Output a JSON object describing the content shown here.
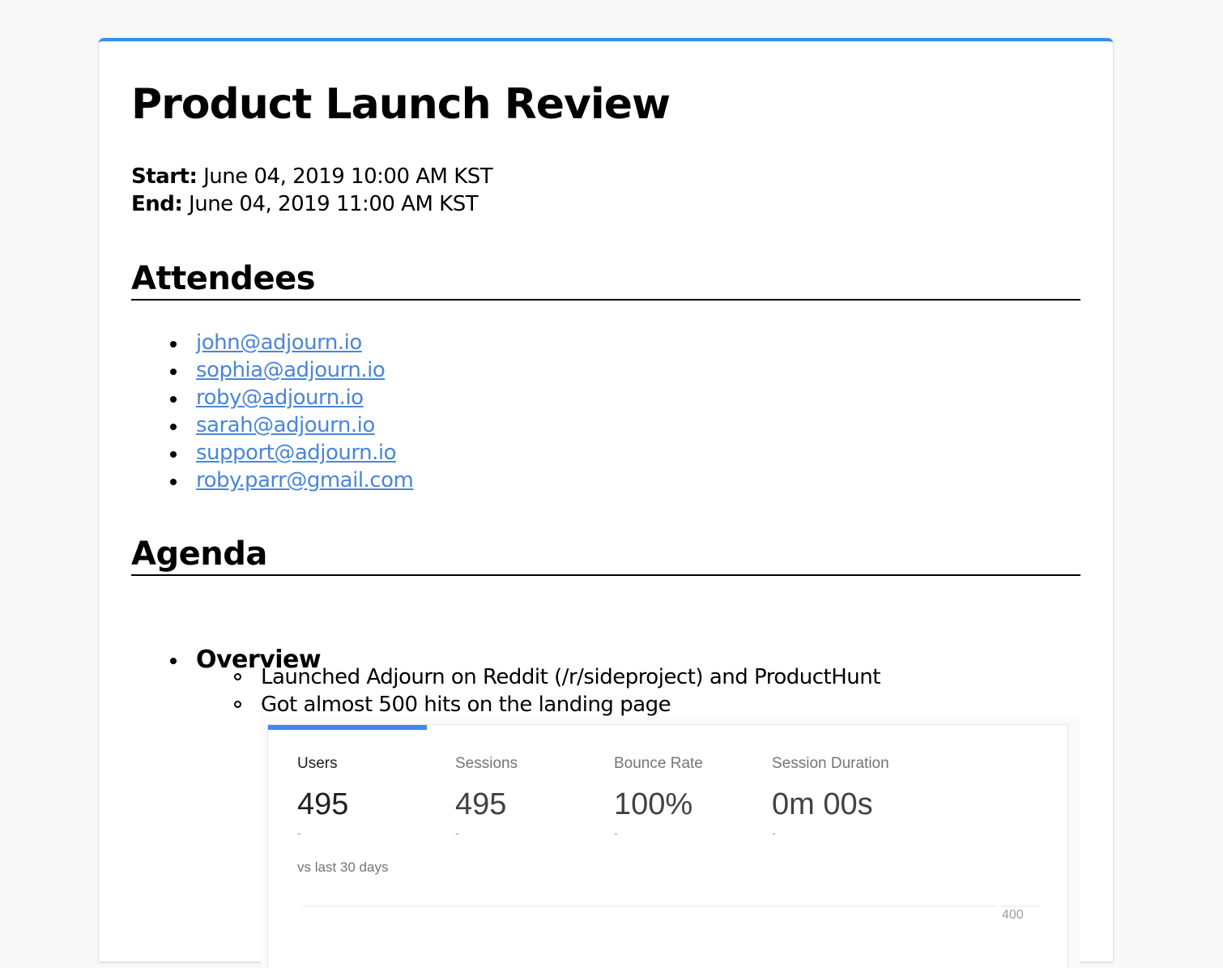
{
  "document": {
    "title": "Product Launch Review",
    "start_label": "Start:",
    "start_value": " June 04, 2019 10:00 AM KST",
    "end_label": "End:",
    "end_value": " June 04, 2019 11:00 AM KST"
  },
  "attendees": {
    "heading": "Attendees",
    "emails": [
      "john@adjourn.io",
      "sophia@adjourn.io",
      "roby@adjourn.io",
      "sarah@adjourn.io",
      "support@adjourn.io",
      "roby.parr@gmail.com"
    ]
  },
  "agenda": {
    "heading": "Agenda",
    "items": [
      {
        "title": "Overview",
        "subitems": [
          "Launched Adjourn on Reddit (/r/sideproject) and ProductHunt",
          "Got almost 500 hits on the landing page"
        ]
      }
    ]
  },
  "analytics": {
    "metrics": [
      {
        "label": "Users",
        "value": "495",
        "delta": "-"
      },
      {
        "label": "Sessions",
        "value": "495",
        "delta": "-"
      },
      {
        "label": "Bounce Rate",
        "value": "100%",
        "delta": "-"
      },
      {
        "label": "Session Duration",
        "value": "0m 00s",
        "delta": "-"
      }
    ],
    "comparison": "vs last 30 days",
    "axis_tick": "400",
    "colors": {
      "accent": "#4285f4"
    }
  },
  "colors": {
    "card_top_border": "#2e8ff0",
    "link": "#4a86d8"
  }
}
